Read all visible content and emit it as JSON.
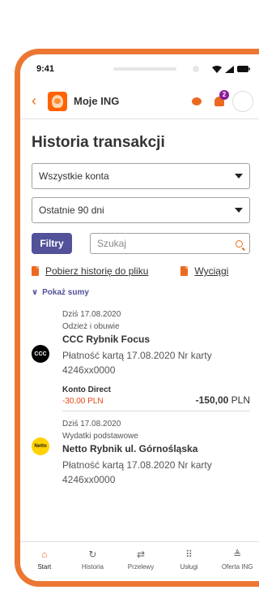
{
  "status": {
    "time": "9:41"
  },
  "appbar": {
    "title": "Moje ING",
    "notification_count": "2"
  },
  "page": {
    "title": "Historia transakcji"
  },
  "filters": {
    "account_select": "Wszystkie konta",
    "period_select": "Ostatnie 90 dni",
    "filter_button": "Filtry",
    "search_placeholder": "Szukaj"
  },
  "links": {
    "download_history": "Pobierz historię do pliku",
    "statements": "Wyciągi"
  },
  "show_sums": "Pokaż sumy",
  "transactions": [
    {
      "date": "Dziś 17.08.2020",
      "category": "Odzież i obuwie",
      "merchant": "CCC Rybnik Focus",
      "description": "Płatność kartą 17.08.2020 Nr karty 4246xx0000",
      "account": "Konto Direct",
      "sub_amount": "-30,00 PLN",
      "amount": "-150,00",
      "currency": "PLN",
      "logo": "CCC"
    },
    {
      "date": "Dziś 17.08.2020",
      "category": "Wydatki podstawowe",
      "merchant": "Netto Rybnik ul. Górnośląska",
      "description": "Płatność kartą 17.08.2020 Nr karty 4246xx0000",
      "logo": "Netto"
    }
  ],
  "tabs": [
    {
      "label": "Start",
      "icon": "home-icon"
    },
    {
      "label": "Historia",
      "icon": "history-icon"
    },
    {
      "label": "Przelewy",
      "icon": "transfer-icon"
    },
    {
      "label": "Usługi",
      "icon": "grid-icon"
    },
    {
      "label": "Oferta ING",
      "icon": "offer-icon"
    }
  ],
  "colors": {
    "accent": "#ec6a1f",
    "primary": "#525199",
    "negative": "#e64415"
  }
}
